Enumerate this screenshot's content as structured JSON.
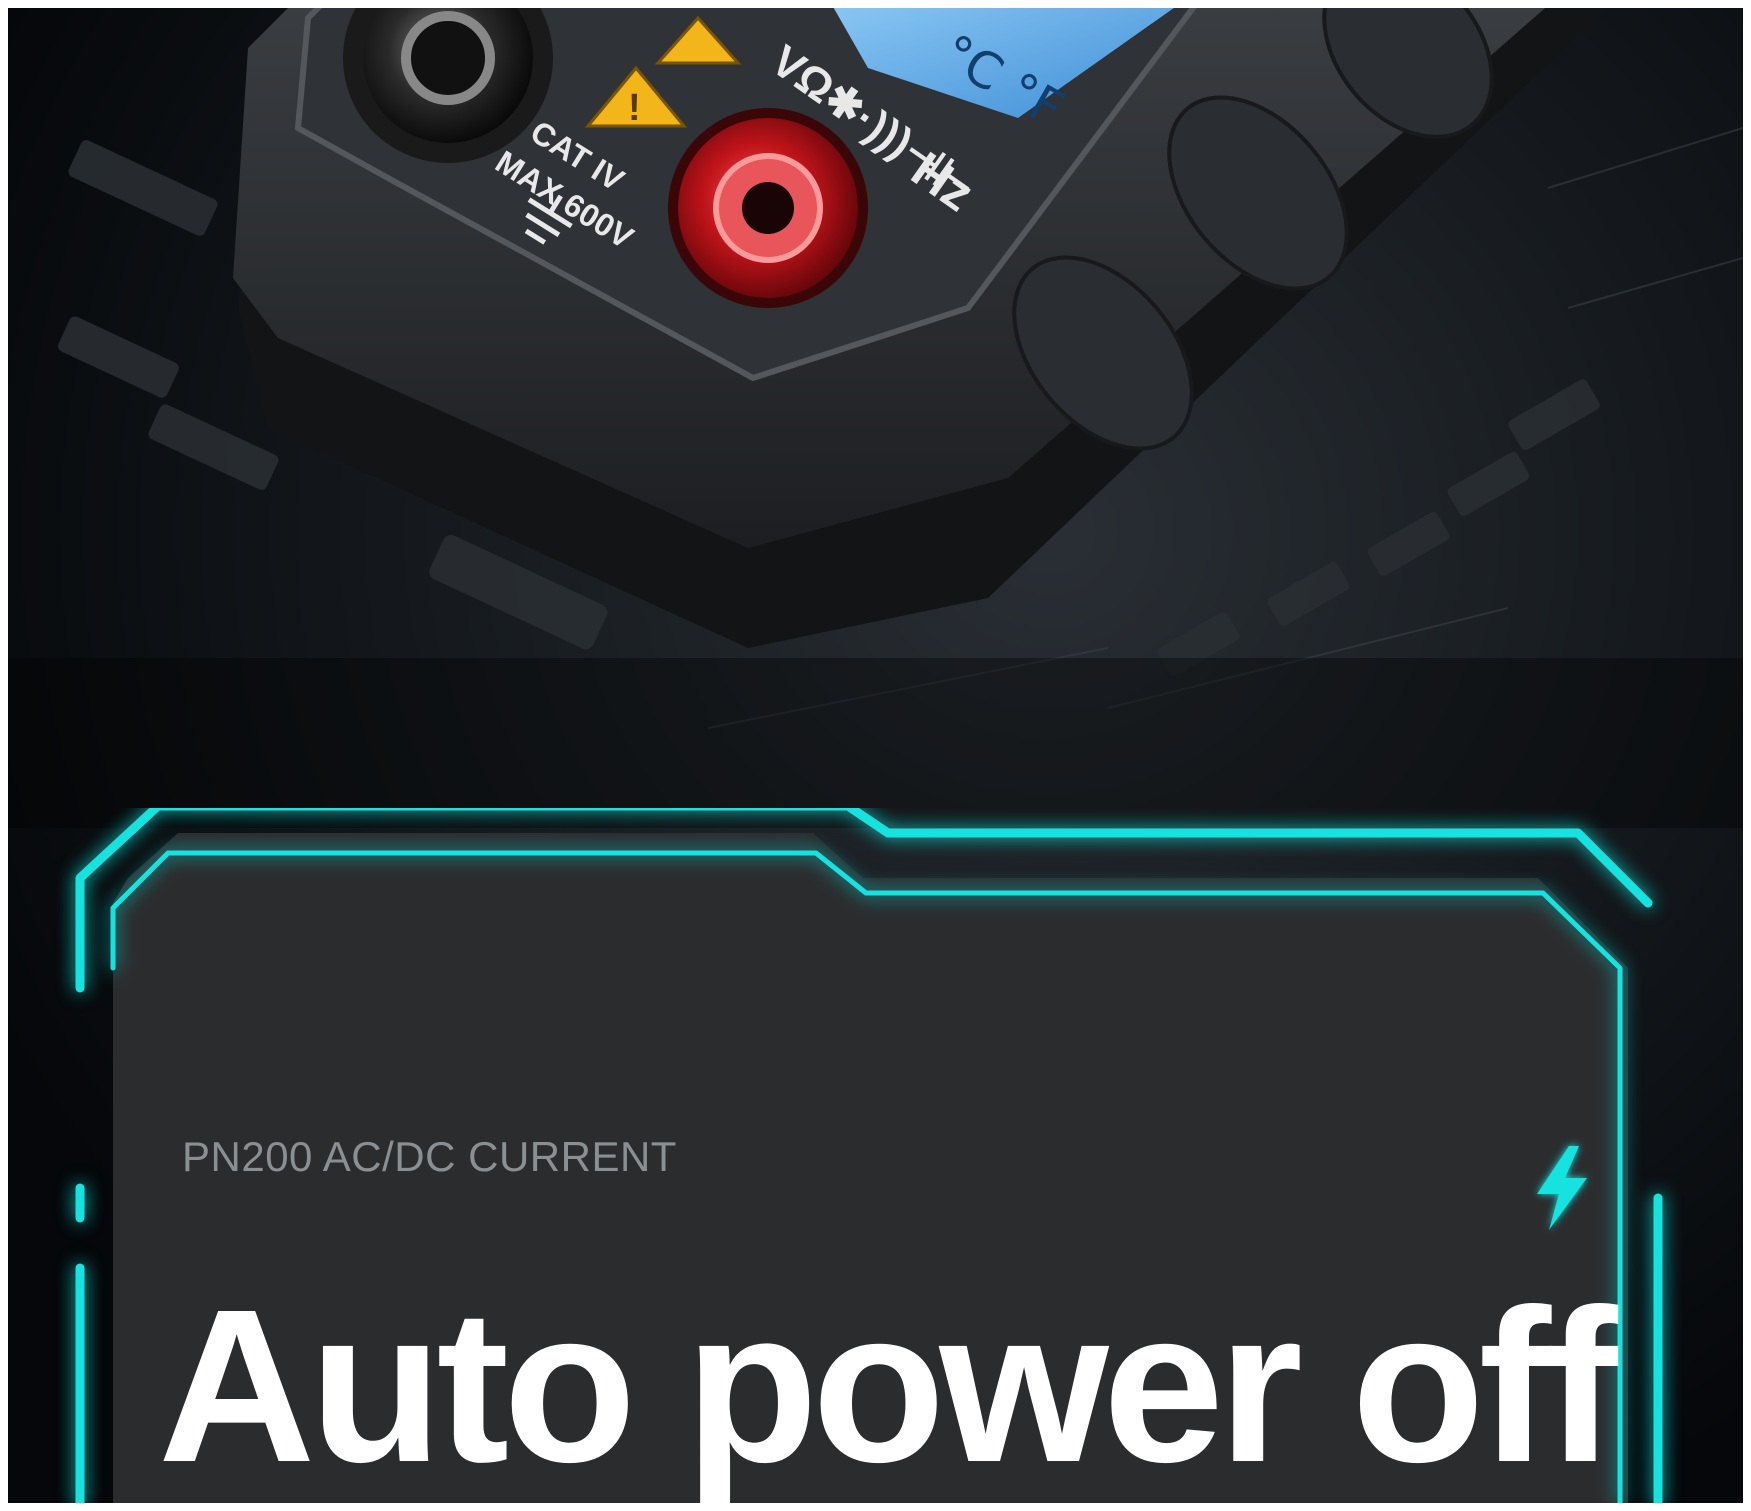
{
  "device_labels": {
    "cat_rating": "CAT IV",
    "max_voltage": "MAX 600V",
    "func_symbols": "VΩ✱·)))⊣⊢",
    "freq_unit": "Hz",
    "temp_units": "°C °F"
  },
  "card": {
    "subtitle": "PN200 AC/DC CURRENT",
    "headline": "Auto power off"
  },
  "colors": {
    "accent_glow": "#19e3e0",
    "card_bg": "#2b2c2e",
    "jack_red": "#c0141a",
    "lcd_blue": "#5aa9ea",
    "warning_yellow": "#f2b51a"
  },
  "icons": {
    "badge": "lightning-bolt-icon",
    "warning": "warning-triangle-icon",
    "ground": "ground-symbol-icon"
  }
}
